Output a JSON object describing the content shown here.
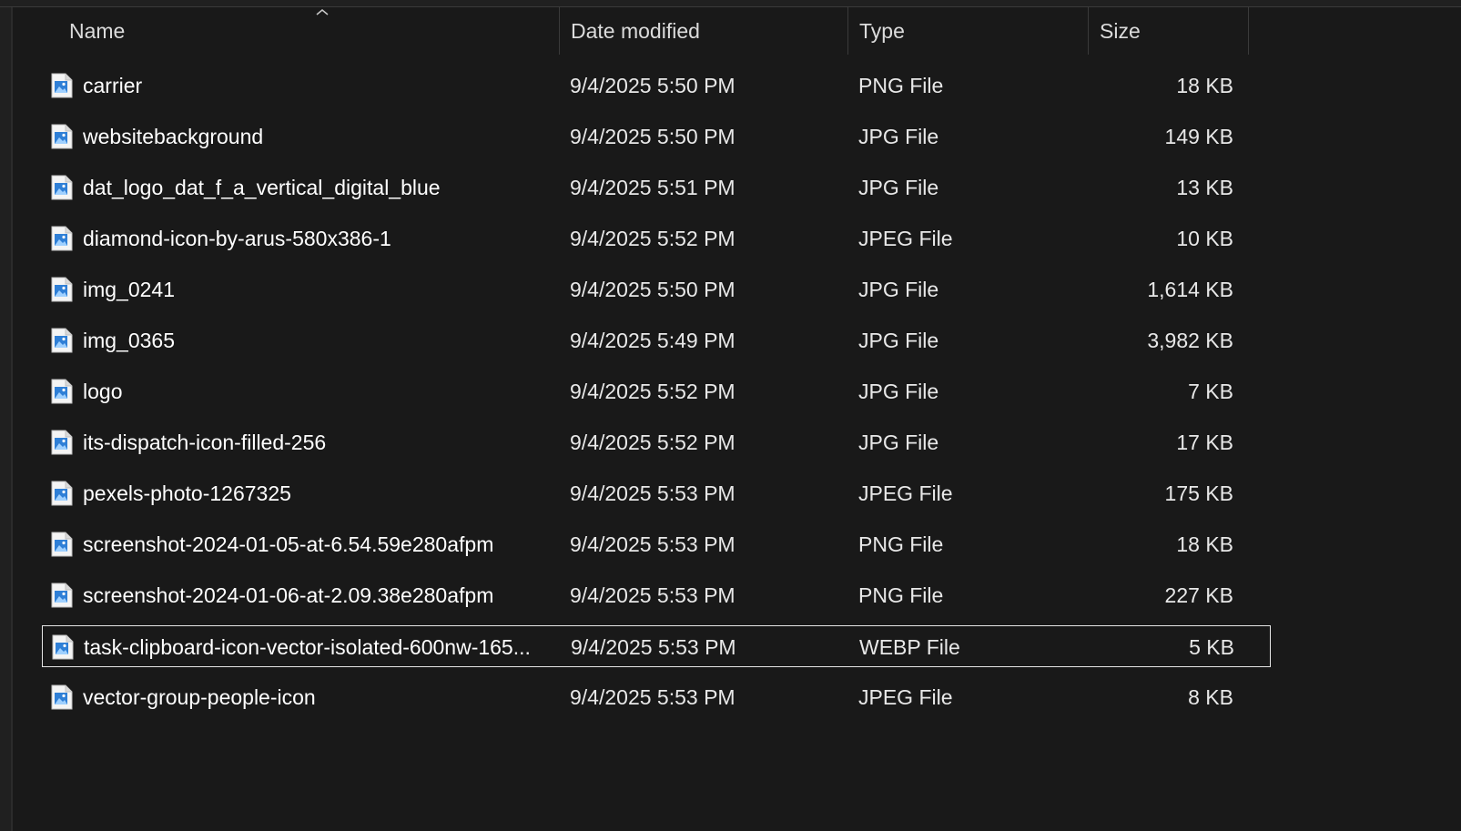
{
  "columns": {
    "name": "Name",
    "date": "Date modified",
    "type": "Type",
    "size": "Size"
  },
  "sort": {
    "column": "Name",
    "indicator": "chevron-up-icon"
  },
  "file_icon": "image-file-icon",
  "selected_index": 11,
  "files": [
    {
      "name": "carrier",
      "date": "9/4/2025 5:50 PM",
      "type": "PNG File",
      "size": "18 KB"
    },
    {
      "name": "websitebackground",
      "date": "9/4/2025 5:50 PM",
      "type": "JPG File",
      "size": "149 KB"
    },
    {
      "name": "dat_logo_dat_f_a_vertical_digital_blue",
      "date": "9/4/2025 5:51 PM",
      "type": "JPG File",
      "size": "13 KB"
    },
    {
      "name": "diamond-icon-by-arus-580x386-1",
      "date": "9/4/2025 5:52 PM",
      "type": "JPEG File",
      "size": "10 KB"
    },
    {
      "name": "img_0241",
      "date": "9/4/2025 5:50 PM",
      "type": "JPG File",
      "size": "1,614 KB"
    },
    {
      "name": "img_0365",
      "date": "9/4/2025 5:49 PM",
      "type": "JPG File",
      "size": "3,982 KB"
    },
    {
      "name": "logo",
      "date": "9/4/2025 5:52 PM",
      "type": "JPG File",
      "size": "7 KB"
    },
    {
      "name": "its-dispatch-icon-filled-256",
      "date": "9/4/2025 5:52 PM",
      "type": "JPG File",
      "size": "17 KB"
    },
    {
      "name": "pexels-photo-1267325",
      "date": "9/4/2025 5:53 PM",
      "type": "JPEG File",
      "size": "175 KB"
    },
    {
      "name": "screenshot-2024-01-05-at-6.54.59e280afpm",
      "date": "9/4/2025 5:53 PM",
      "type": "PNG File",
      "size": "18 KB"
    },
    {
      "name": "screenshot-2024-01-06-at-2.09.38e280afpm",
      "date": "9/4/2025 5:53 PM",
      "type": "PNG File",
      "size": "227 KB"
    },
    {
      "name": "task-clipboard-icon-vector-isolated-600nw-165...",
      "date": "9/4/2025 5:53 PM",
      "type": "WEBP File",
      "size": "5 KB"
    },
    {
      "name": "vector-group-people-icon",
      "date": "9/4/2025 5:53 PM",
      "type": "JPEG File",
      "size": "8 KB"
    }
  ]
}
